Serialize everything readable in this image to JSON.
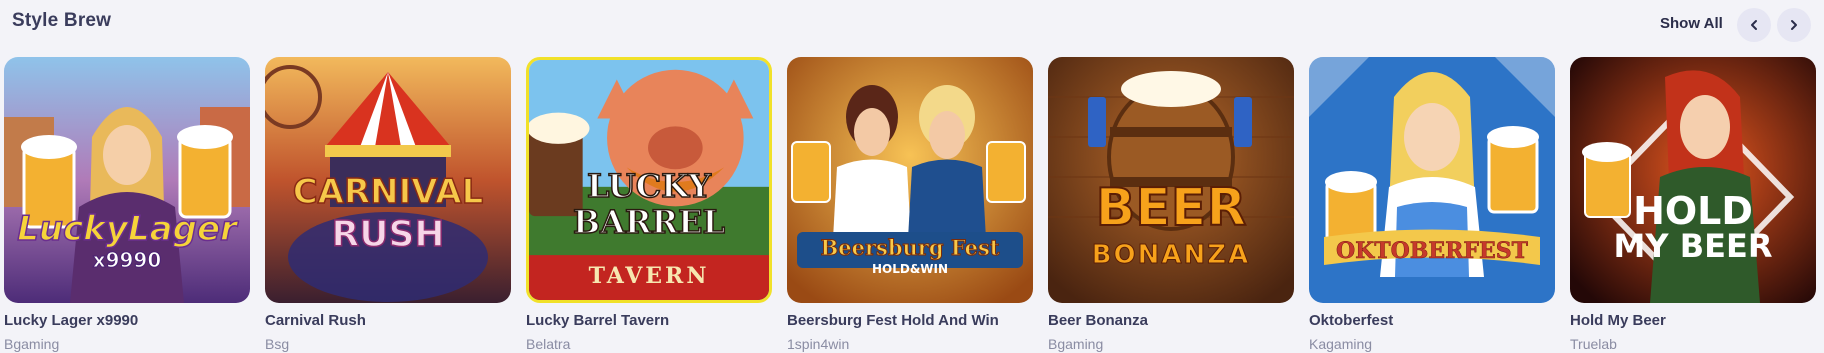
{
  "section": {
    "title": "Style Brew",
    "show_all_label": "Show All"
  },
  "nav": {
    "prev_icon": "chevron-left-icon",
    "next_icon": "chevron-right-icon"
  },
  "games": [
    {
      "title": "Lucky Lager x9990",
      "provider": "Bgaming",
      "logo_line1": "LuckyLager",
      "logo_line2": "x9990",
      "colors": [
        "#7a4fa0",
        "#f6c646",
        "#e8b93a"
      ]
    },
    {
      "title": "Carnival Rush",
      "provider": "Bsg",
      "logo_line1": "CARNIVAL",
      "logo_line2": "RUSH",
      "colors": [
        "#3b2d5a",
        "#d9331f",
        "#f2c94c"
      ]
    },
    {
      "title": "Lucky Barrel Tavern",
      "provider": "Belatra",
      "logo_line1": "LUCKY",
      "logo_line2": "BARREL",
      "logo_line3": "TAVERN",
      "colors": [
        "#6fb7e8",
        "#2f6b2e",
        "#c62828"
      ]
    },
    {
      "title": "Beersburg Fest Hold And Win",
      "provider": "1spin4win",
      "logo_line1": "Beersburg Fest",
      "logo_line2": "HOLD&WIN",
      "colors": [
        "#c9721e",
        "#f3b53c",
        "#1f4f8f"
      ]
    },
    {
      "title": "Beer Bonanza",
      "provider": "Bgaming",
      "logo_line1": "BEER",
      "logo_line2": "BONANZA",
      "colors": [
        "#6b3a12",
        "#f7a21b",
        "#9b5a24"
      ]
    },
    {
      "title": "Oktoberfest",
      "provider": "Kagaming",
      "logo_line1": "OKTOBERFEST",
      "colors": [
        "#2d74c7",
        "#f3c84b",
        "#c6392b"
      ]
    },
    {
      "title": "Hold My Beer",
      "provider": "Truelab",
      "logo_line1": "HOLD",
      "logo_line2": "MY BEER",
      "colors": [
        "#2a0d0a",
        "#d7421d",
        "#f3b23d"
      ]
    }
  ]
}
